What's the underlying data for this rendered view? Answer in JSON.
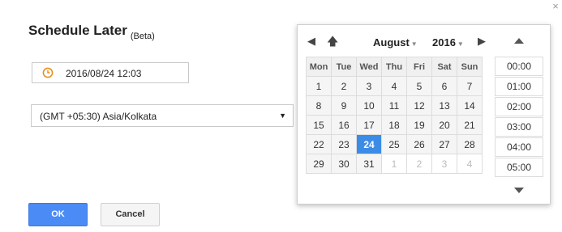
{
  "dialog": {
    "title": "Schedule Later",
    "beta": "(Beta)",
    "close": "×",
    "datetime_value": "2016/08/24 12:03",
    "timezone_value": "(GMT +05:30) Asia/Kolkata",
    "ok_label": "OK",
    "cancel_label": "Cancel"
  },
  "picker": {
    "month": "August",
    "year": "2016",
    "weekdays": [
      "Mon",
      "Tue",
      "Wed",
      "Thu",
      "Fri",
      "Sat",
      "Sun"
    ],
    "weeks": [
      [
        "1",
        "2",
        "3",
        "4",
        "5",
        "6",
        "7"
      ],
      [
        "8",
        "9",
        "10",
        "11",
        "12",
        "13",
        "14"
      ],
      [
        "15",
        "16",
        "17",
        "18",
        "19",
        "20",
        "21"
      ],
      [
        "22",
        "23",
        "24",
        "25",
        "26",
        "27",
        "28"
      ],
      [
        "29",
        "30",
        "31",
        "1",
        "2",
        "3",
        "4"
      ]
    ],
    "selected_day": "24",
    "times": [
      "00:00",
      "01:00",
      "02:00",
      "03:00",
      "04:00",
      "05:00"
    ]
  },
  "icons": {
    "clock": "clock-icon",
    "prev": "arrow-left-icon",
    "up": "arrow-up-icon",
    "next": "arrow-right-icon",
    "time_up": "triangle-up-icon",
    "time_down": "triangle-down-icon"
  },
  "colors": {
    "accent_blue": "#4b8bf5",
    "selected_day": "#3b8ce6",
    "clock_orange": "#e8901f"
  }
}
